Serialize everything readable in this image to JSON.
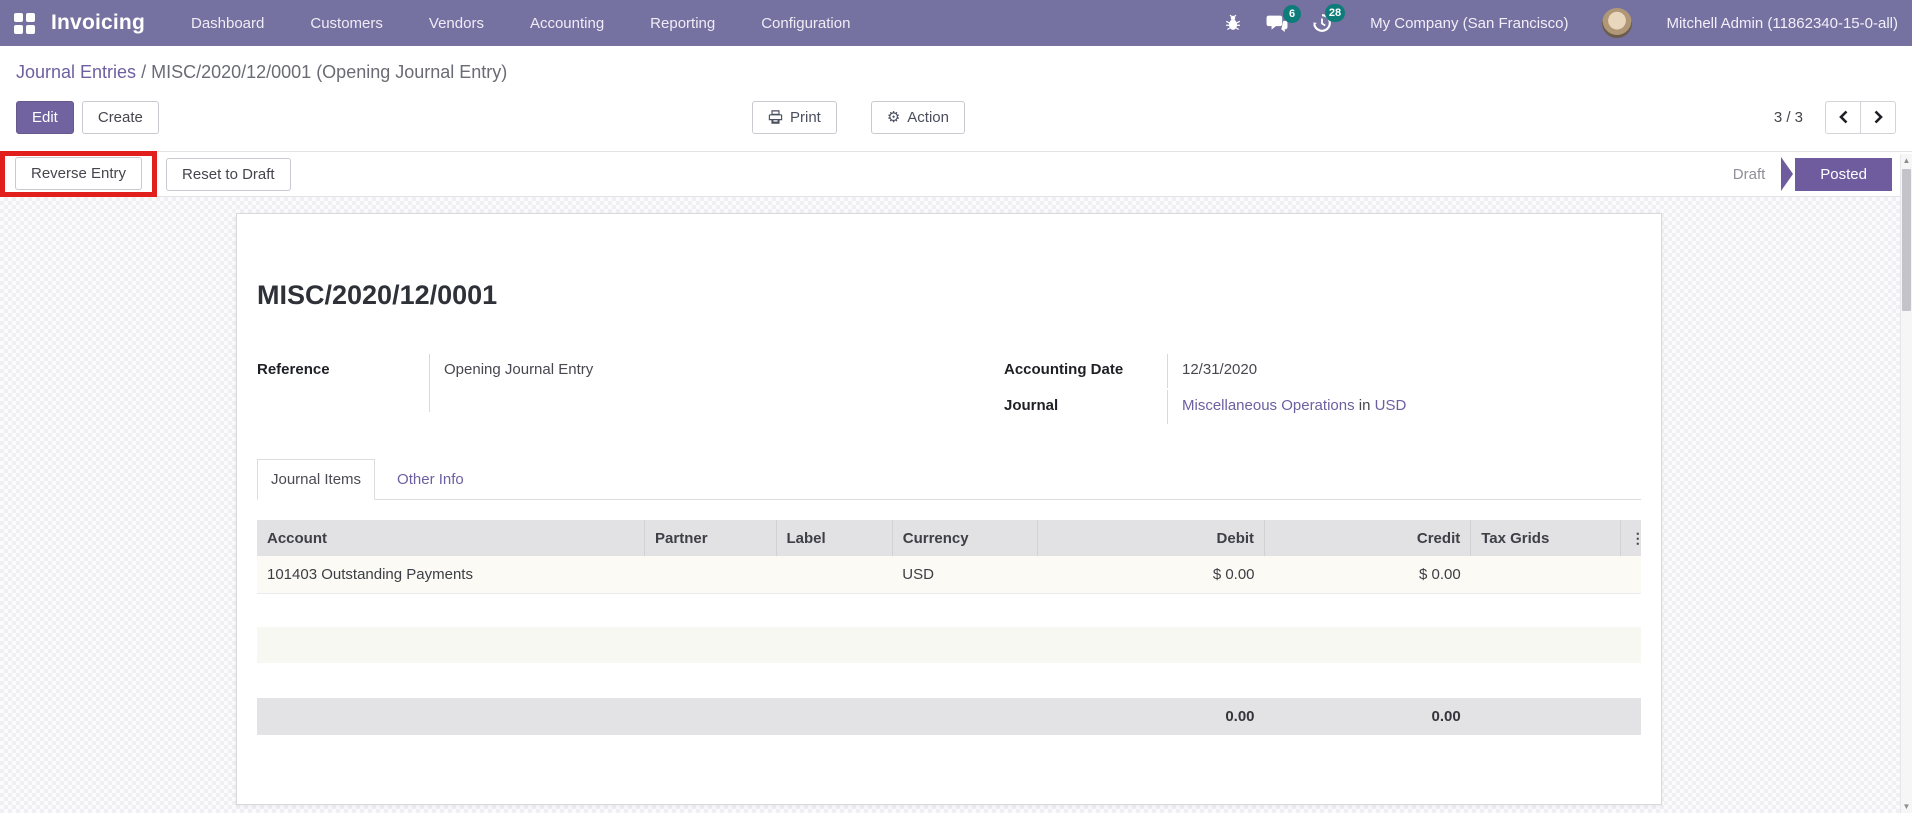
{
  "colors": {
    "navbar_bg": "#7571a0",
    "primary_purple": "#71639f",
    "posted_purple": "#6f5c9e",
    "link_purple": "#6d5fa0",
    "badge_teal": "#0e7d79",
    "highlight_red": "#e11f1d"
  },
  "navbar": {
    "app_name": "Invoicing",
    "menu_items": [
      "Dashboard",
      "Customers",
      "Vendors",
      "Accounting",
      "Reporting",
      "Configuration"
    ],
    "badges": {
      "messages": "6",
      "activities": "28"
    },
    "company": "My Company (San Francisco)",
    "user": "Mitchell Admin (11862340-15-0-all)"
  },
  "breadcrumb": {
    "parent": "Journal Entries",
    "separator": " / ",
    "current": "MISC/2020/12/0001 (Opening Journal Entry)"
  },
  "control_panel": {
    "edit_label": "Edit",
    "create_label": "Create",
    "print_label": "Print",
    "action_label": "Action",
    "pager_value": "3 / 3"
  },
  "statusbar": {
    "reverse_entry_label": "Reverse Entry",
    "reset_to_draft_label": "Reset to Draft",
    "draft_label": "Draft",
    "posted_label": "Posted"
  },
  "form": {
    "title": "MISC/2020/12/0001",
    "reference_label": "Reference",
    "reference_value": "Opening Journal Entry",
    "accounting_date_label": "Accounting Date",
    "accounting_date_value": "12/31/2020",
    "journal_label": "Journal",
    "journal_value": "Miscellaneous Operations",
    "journal_in": "in",
    "journal_currency": "USD",
    "tabs": [
      {
        "label": "Journal Items",
        "active": true
      },
      {
        "label": "Other Info",
        "active": false
      }
    ],
    "table": {
      "columns": [
        "Account",
        "Partner",
        "Label",
        "Currency",
        "Debit",
        "Credit",
        "Tax Grids"
      ],
      "rows": [
        {
          "account": "101403 Outstanding Payments",
          "partner": "",
          "label": "",
          "currency": "USD",
          "debit": "$ 0.00",
          "credit": "$ 0.00",
          "tax_grids": ""
        }
      ],
      "totals": {
        "debit": "0.00",
        "credit": "0.00"
      }
    }
  },
  "icons": {
    "gear_glyph": "⚙",
    "kebab_glyph": "⋮",
    "scroll_up_glyph": "▲",
    "scroll_down_glyph": "▼"
  }
}
